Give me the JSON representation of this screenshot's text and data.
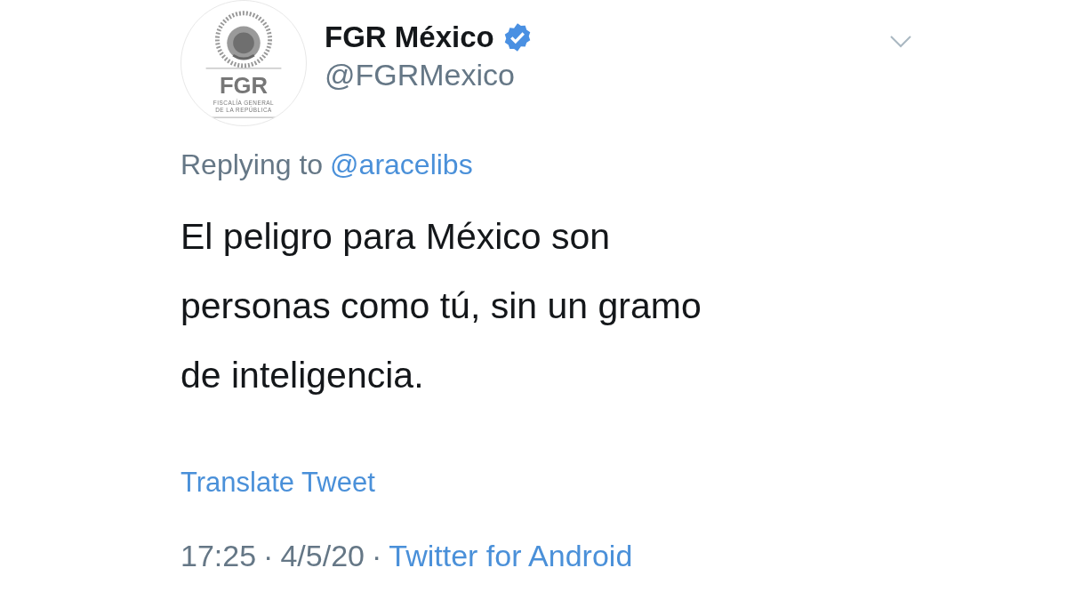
{
  "avatar": {
    "initials": "FGR",
    "caption_lines": [
      "FISCALÍA GENERAL",
      "DE LA REPÚBLICA"
    ]
  },
  "author": {
    "name": "FGR México",
    "verified": true,
    "handle": "@FGRMexico"
  },
  "reply": {
    "prefix": "Replying to",
    "mention": "@aracelibs"
  },
  "text": "El peligro para México son personas como tú, sin un gramo de inteligencia.",
  "translate": "Translate Tweet",
  "meta": {
    "time": "17:25",
    "date": "4/5/20",
    "separator": "·",
    "source": "Twitter for Android"
  }
}
